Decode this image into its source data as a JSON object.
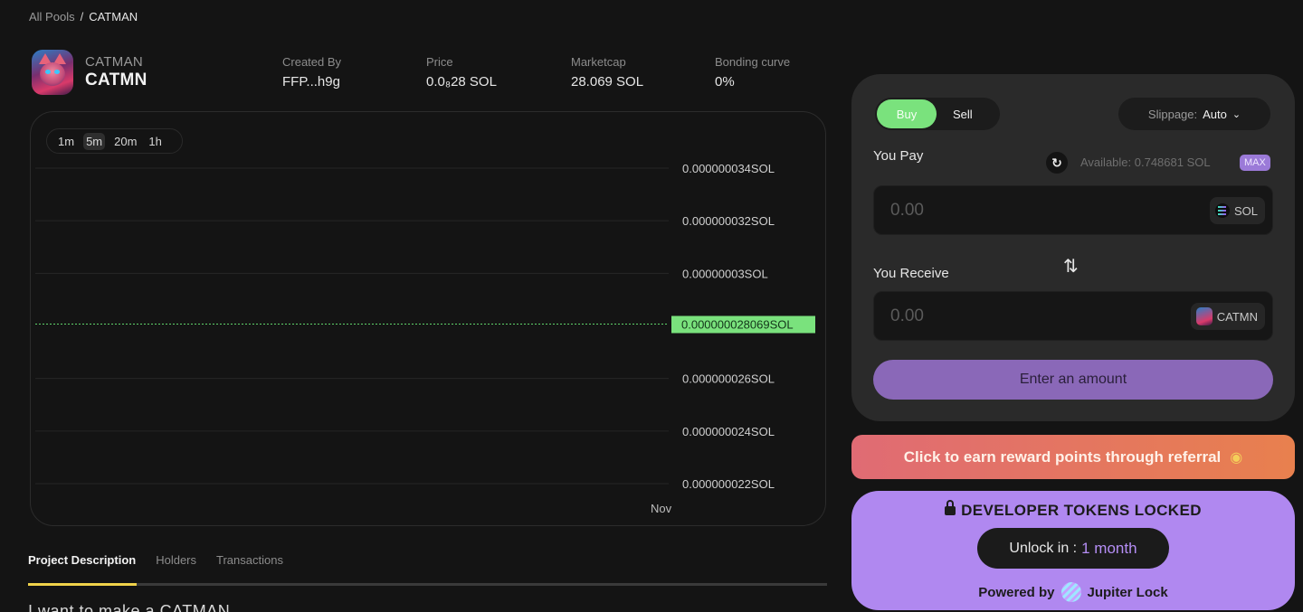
{
  "breadcrumb": {
    "root": "All Pools",
    "separator": "/",
    "current": "CATMAN"
  },
  "token": {
    "name": "CATMAN",
    "symbol": "CATMN"
  },
  "stats": [
    {
      "label": "Created By",
      "value": "FFP...h9g"
    },
    {
      "label": "Price",
      "value": "0.0₈28 SOL"
    },
    {
      "label": "Marketcap",
      "value": "28.069 SOL"
    },
    {
      "label": "Bonding curve",
      "value": "0%"
    }
  ],
  "chart": {
    "intervals": [
      "1m",
      "5m",
      "20m",
      "1h"
    ],
    "active_interval": "5m",
    "price_tag": "0.000000028069SOL",
    "x_label": "Nov"
  },
  "chart_data": {
    "type": "line",
    "title": "",
    "xlabel": "",
    "ylabel": "",
    "y_ticks": [
      3.4e-08,
      3.2e-08,
      3e-08,
      2.6e-08,
      2.4e-08,
      2.2e-08
    ],
    "y_tick_labels": [
      "0.000000034SOL",
      "0.000000032SOL",
      "0.00000003SOL",
      "0.000000026SOL",
      "0.000000024SOL",
      "0.000000022SOL"
    ],
    "ylim": [
      2.2e-08,
      3.4e-08
    ],
    "x_tick_labels": [
      "Nov"
    ],
    "series": [
      {
        "values": [
          2.8069e-08,
          2.8069e-08
        ]
      }
    ],
    "current_value": 2.8069e-08,
    "current_label": "0.000000028069SOL",
    "grid": true
  },
  "tabs": [
    "Project Description",
    "Holders",
    "Transactions"
  ],
  "active_tab": "Project Description",
  "description_peek": "I want to make a CATMAN",
  "swap": {
    "buy_label": "Buy",
    "sell_label": "Sell",
    "slippage_label": "Slippage:",
    "slippage_value": "Auto",
    "you_pay_label": "You Pay",
    "available_text": "Available: 0.748681 SOL",
    "max_label": "MAX",
    "pay_value": "0.00",
    "pay_token": "SOL",
    "you_receive_label": "You Receive",
    "receive_value": "0.00",
    "receive_token": "CATMN",
    "cta_label": "Enter an amount"
  },
  "referral": {
    "label": "Click to earn reward points through referral"
  },
  "lock": {
    "title": "DEVELOPER TOKENS LOCKED",
    "unlock_label": "Unlock in :",
    "unlock_value": "1 month",
    "powered_by": "Powered by",
    "provider": "Jupiter Lock"
  },
  "colors": {
    "buy": "#7ae27d",
    "cta": "#8a68b8",
    "lock_card": "#b088f0",
    "price_tag": "#7ae27d",
    "tab_indicator": "#f0d24a"
  }
}
